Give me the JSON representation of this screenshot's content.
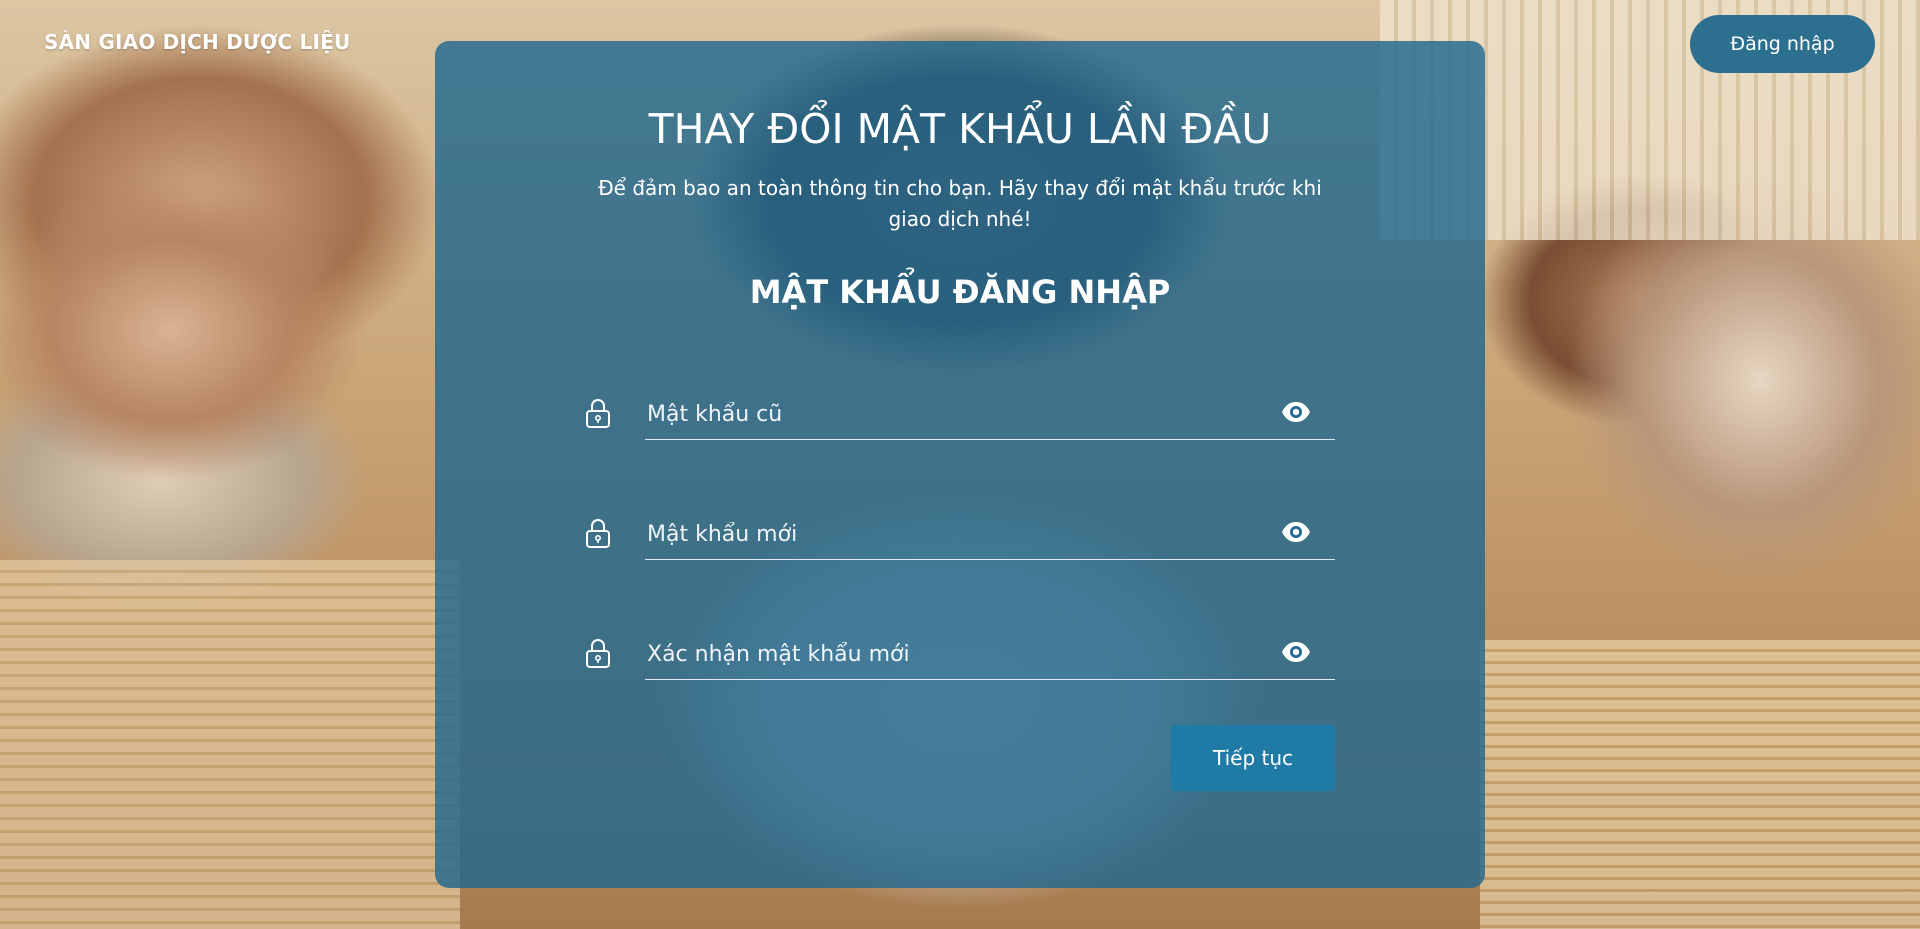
{
  "header": {
    "brand": "SÀN GIAO DỊCH DƯỢC LIỆU",
    "login_label": "Đăng nhập"
  },
  "card": {
    "title": "THAY ĐỔI MẬT KHẨU LẦN ĐẦU",
    "subtitle": "Để đảm bao an toàn thông tin cho bạn. Hãy thay đổi mật khẩu trước khi giao dịch nhé!",
    "section_title": "MẬT KHẨU ĐĂNG NHẬP",
    "fields": [
      {
        "placeholder": "Mật khẩu cũ",
        "value": "",
        "icon": "lock-icon",
        "toggle_icon": "eye-icon"
      },
      {
        "placeholder": "Mật khẩu mới",
        "value": "",
        "icon": "lock-icon",
        "toggle_icon": "eye-icon"
      },
      {
        "placeholder": "Xác nhận mật khẩu mới",
        "value": "",
        "icon": "lock-icon",
        "toggle_icon": "eye-icon"
      }
    ],
    "submit_label": "Tiếp tục"
  },
  "colors": {
    "card_overlay": "#21688f",
    "login_button": "#2d6f8f",
    "submit_button": "#1f7ba6",
    "text": "#ffffff"
  }
}
